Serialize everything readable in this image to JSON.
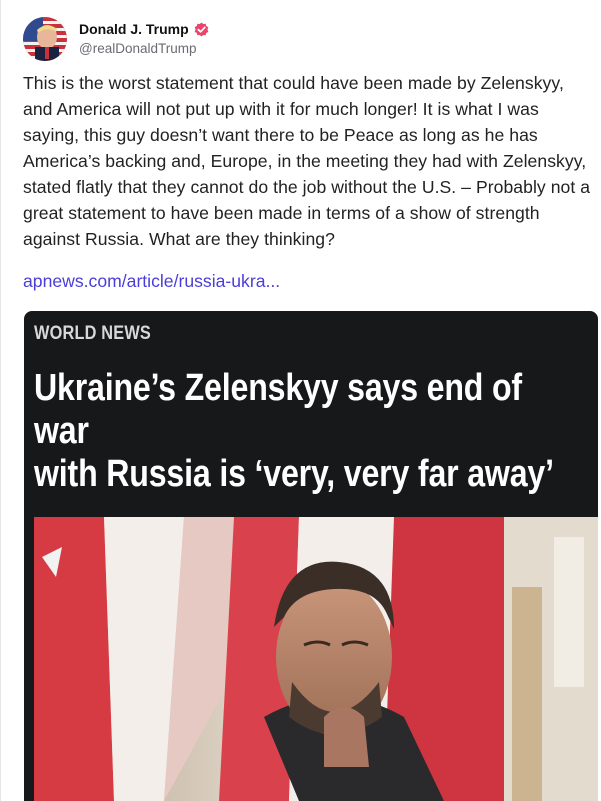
{
  "post": {
    "author": {
      "display_name": "Donald J. Trump",
      "handle": "@realDonaldTrump",
      "verified_icon": "verified-badge-icon",
      "avatar_icon": "avatar-image"
    },
    "body": "This is the worst statement that could have been made by Zelenskyy, and America will not put up with it for much longer! It is what I was saying, this guy doesn’t want there to be Peace as long as he has America’s backing and, Europe, in the meeting they had with Zelenskyy, stated flatly that they cannot do the job without the U.S. – Probably not a great statement to have been made in terms of a show of strength against Russia. What are they thinking?",
    "link_text": "apnews.com/article/russia-ukra...",
    "link_color": "#4a3dd8"
  },
  "card": {
    "eyebrow": "WORLD NEWS",
    "headline_line1": "Ukraine’s Zelenskyy says end of war",
    "headline_line2": "with Russia is ‘very, very far away’",
    "background": "#17181a",
    "image_icon": "article-photo"
  },
  "colors": {
    "verified": "#e8466b",
    "handle": "#6b6b73"
  }
}
